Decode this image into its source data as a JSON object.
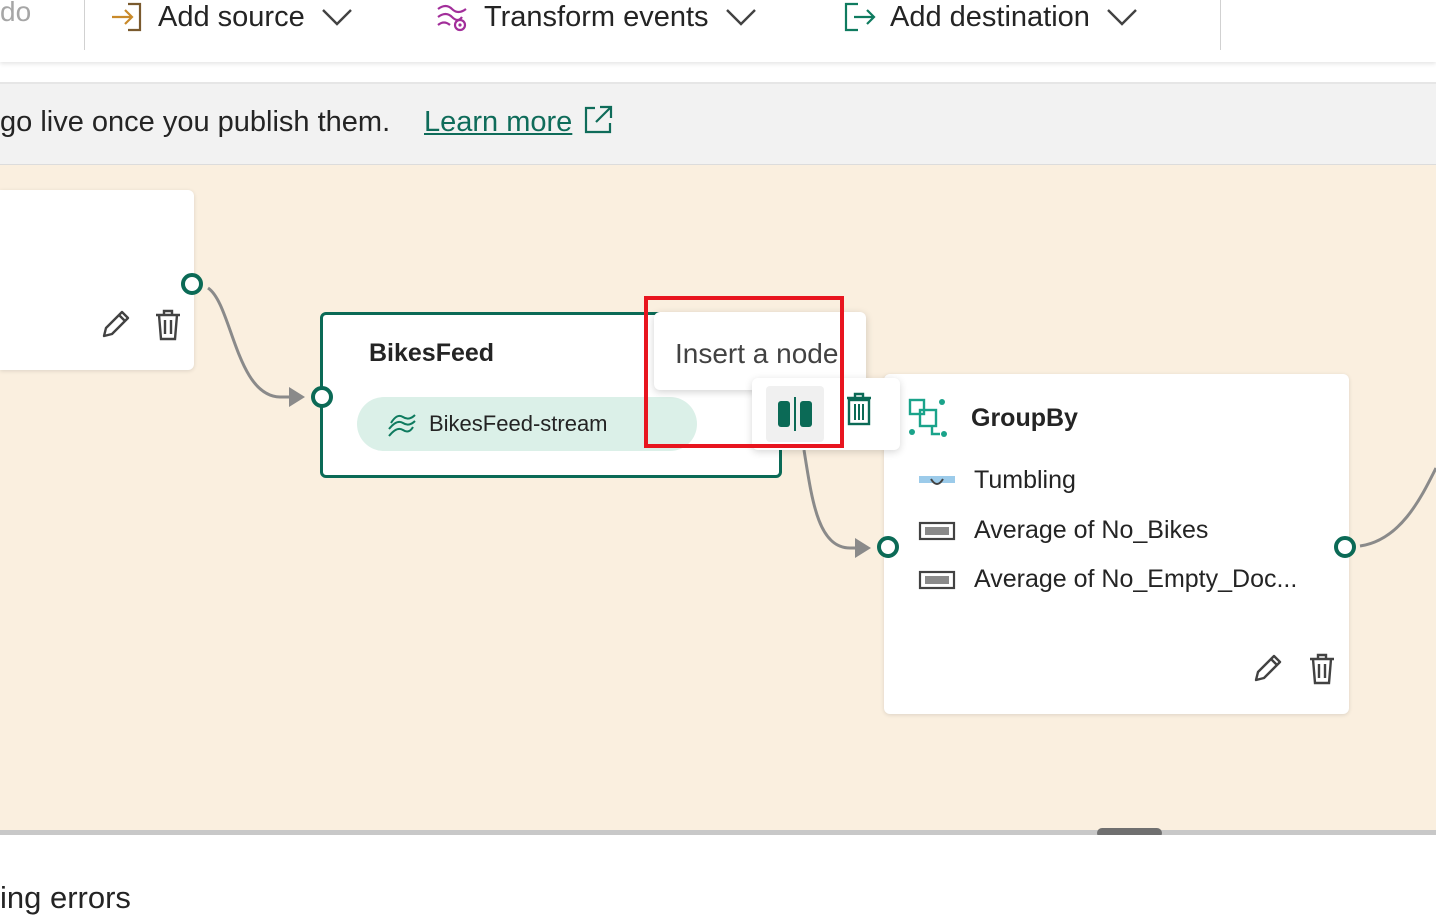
{
  "toolbar": {
    "undo_fragment": "do",
    "add_source": "Add source",
    "transform_events": "Transform events",
    "add_destination": "Add destination"
  },
  "banner": {
    "text": "go live once you publish them.",
    "link": "Learn more"
  },
  "nodes": {
    "source_card": {},
    "bikesfeed": {
      "title": "BikesFeed",
      "stream_label": "BikesFeed-stream"
    },
    "groupby": {
      "title": "GroupBy",
      "rows": [
        "Tumbling",
        "Average of No_Bikes",
        "Average of No_Empty_Doc..."
      ]
    }
  },
  "tooltip": {
    "text": "Insert a node"
  },
  "bottom": {
    "text_fragment": "ing errors"
  },
  "colors": {
    "accent": "#0b6a56",
    "canvas": "#faefdf",
    "highlight": "#e8151f",
    "pill": "#dbf0e8",
    "transform_icon": "#a22e9a"
  },
  "icons": {
    "add_source": "sign-in-icon",
    "transform": "transform-icon",
    "add_destination": "sign-out-icon",
    "external": "external-link-icon",
    "edit": "pencil-icon",
    "delete": "trash-icon",
    "insert": "insert-node-icon",
    "stream": "stream-icon",
    "groupby": "groupby-icon",
    "tumbling": "tumbling-window-icon",
    "aggregate": "aggregate-icon"
  }
}
